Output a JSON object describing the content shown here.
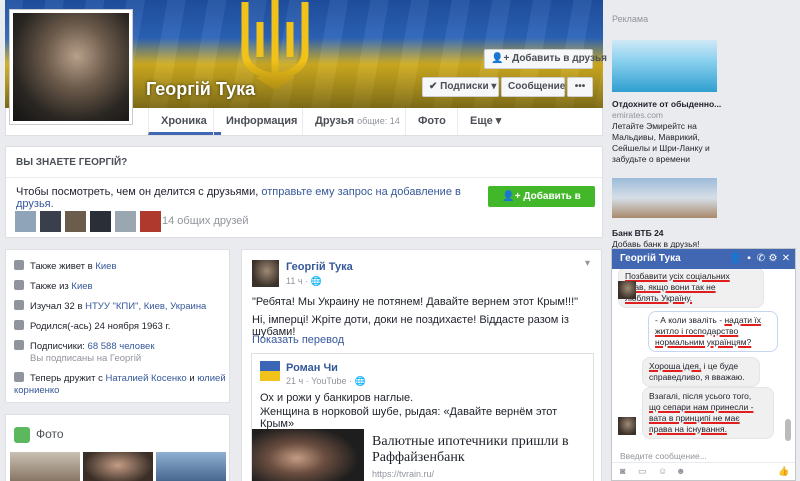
{
  "profile": {
    "name": "Георгій Тука",
    "add_friend_label": "Добавить в друзья",
    "subscribe_label": "Подписки",
    "message_label": "Сообщение",
    "more_label": "•••"
  },
  "tabs": {
    "timeline": "Хроника",
    "info": "Информация",
    "friends": "Друзья",
    "friends_count": "общие: 14",
    "photos": "Фото",
    "more": "Еще"
  },
  "know": {
    "title": "ВЫ ЗНАЕТЕ ГЕОРГІЙ?",
    "text_start": "Чтобы посмотреть, чем он делится с друзьями,",
    "text_link": "отправьте ему запрос на добавление в друзья.",
    "add_button": "Добавить в друзья",
    "common_friends": "14 общих друзей"
  },
  "intro": {
    "also_lives_label": "Также живет в",
    "also_lives_city": "Киев",
    "from_label": "Также из",
    "from_city": "Киев",
    "studied": "Изучал 32 в",
    "studied_school": "НТУУ \"КПИ\", Киев, Украина",
    "born": "Родился(-ась) 24 ноября 1963 г.",
    "followers_label": "Подписчики:",
    "followers_count": "68 588 человек",
    "followers_sub": "Вы подписаны на Георгій",
    "friends_with_label": "Теперь дружит с",
    "friends_with_1": "Наталией Косенко",
    "friends_with_and": "и",
    "friends_with_2": "юлией корниенко"
  },
  "photos": {
    "title": "Фото"
  },
  "post": {
    "author": "Георгій Тука",
    "time": "11 ч · 🌐",
    "text1": "\"Ребята! Мы Украину не потянем! Давайте вернем этот Крым!!!\"",
    "text2": "Ні, імперці! Жріте доти, доки не поздихаєте! Віддасте разом із шубами!",
    "translate": "Показать перевод",
    "shared": {
      "author": "Роман Чи",
      "time": "21 ч · YouTube · 🌐",
      "text1": "Ох и рожи у банкиров наглые.",
      "text2": "Женщина в норковой шубе, рыдая: «Давайте вернём этот Крым»",
      "link_title": "Валютные ипотечники пришли в Раффайзенбанк",
      "link_domain": "https://tvrain.ru/"
    }
  },
  "ads": {
    "title": "Реклама",
    "ad1_title": "Отдохните от обыденно...",
    "ad1_domain": "emirates.com",
    "ad1_text": "Летайте Эмирейтс на Мальдивы, Маврикий, Сейшелы и Шри-Ланку и забудьте о времени",
    "ad2_title": "Банк ВТБ 24",
    "ad2_text": "Добавь банк в друзья!"
  },
  "chat": {
    "title": "Георгій Тука",
    "msg1_a": "Позбавити усіх соціальних",
    "msg1_b": "прав, якщо вони так не",
    "msg1_c": "люблять Україну.",
    "msg2_a": "- А коли зваліть -",
    "msg2_b": "надати їх",
    "msg2_c": "житло і господарство",
    "msg2_d": "нормальним українцям?",
    "msg3_a": "Хороша ідея,",
    "msg3_b": "і це буде",
    "msg3_c": "справедливо, я вважаю.",
    "msg4_a": "Взагалі, після усього того,",
    "msg4_b": "що сепари нам принесли -",
    "msg4_c": "вата в принципі не має",
    "msg4_d": "права на існування.",
    "input_placeholder": "Введите сообщение..."
  }
}
